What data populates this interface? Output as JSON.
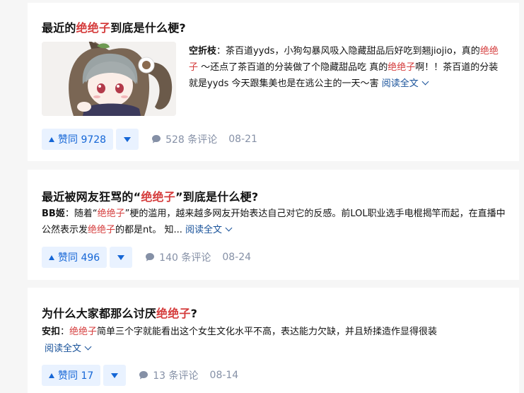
{
  "colors": {
    "highlight": "#d53d3d",
    "link": "#175199",
    "vote": "#1566d6",
    "vote_bg": "#e9f2ff",
    "meta": "#8590a6"
  },
  "cards": [
    {
      "title": {
        "pre": "最近的",
        "hl": "绝绝子",
        "post": "到底是什么梗?"
      },
      "excerpt": {
        "author": "空折枝",
        "sep": "：",
        "parts": [
          "茶百道yyds，小狗勾暴风吸入隐藏甜品后好吃到翘jiojio，真的",
          "绝绝子",
          " ～还点了茶百道的分装做了个隐藏甜品吃 真的",
          "绝绝子",
          "啊！！茶百道的分装就是yyds 今天跟集美也是在逃公主的一天～害 "
        ],
        "read_more": "阅读全文"
      },
      "image_icon": "anime-girl-thumbnail",
      "vote_label": "赞同 9728",
      "comments": "528 条评论",
      "date": "08-21"
    },
    {
      "title": {
        "pre": "最近被网友狂骂的“",
        "hl": "绝绝子",
        "post": "”到底是什么梗?"
      },
      "excerpt": {
        "author": "BB姬",
        "sep": "：",
        "parts": [
          "随着“",
          "绝绝子",
          "”梗的滥用，越来越多网友开始表达自己对它的反感。前LOL职业选手电棍揭竿而起，在直播中公然表示发",
          "绝绝子",
          "的都是nt。 知... "
        ],
        "read_more": "阅读全文"
      },
      "vote_label": "赞同 496",
      "comments": "140 条评论",
      "date": "08-24"
    },
    {
      "title": {
        "pre": "为什么大家都那么讨厌",
        "hl": "绝绝子",
        "post": "?"
      },
      "excerpt": {
        "author": "安扣",
        "sep": "：",
        "parts": [
          "",
          "绝绝子",
          "简单三个字就能看出这个女生文化水平不高，表达能力欠缺，并且矫揉造作显得很装"
        ],
        "read_more": "阅读全文"
      },
      "vote_label": "赞同 17",
      "comments": "13 条评论",
      "date": "08-14"
    }
  ]
}
